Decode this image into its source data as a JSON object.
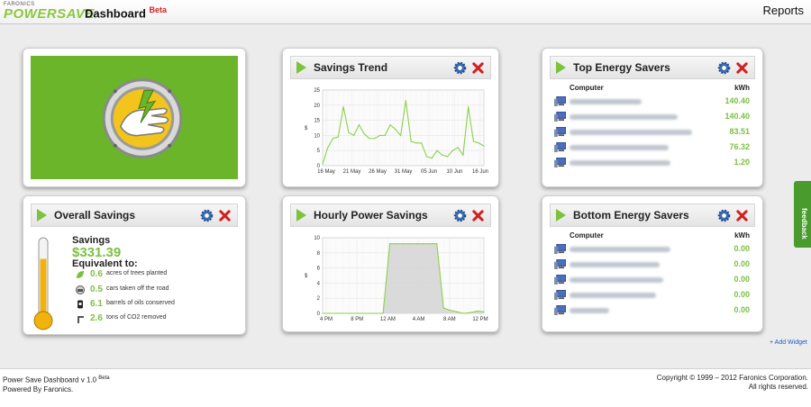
{
  "header": {
    "logo_sub": "FARONICS",
    "logo_main": "POWERSAVE",
    "app_title": "Dashboard",
    "beta": "Beta",
    "reports": "Reports"
  },
  "colors": {
    "accent_green": "#7ac142",
    "logo_green": "#6bb52b",
    "close_red": "#d21f1f"
  },
  "widgets": {
    "savings_trend": {
      "title": "Savings Trend"
    },
    "top_savers": {
      "title": "Top Energy Savers",
      "col_computer": "Computer",
      "col_kwh": "kWh",
      "rows": [
        {
          "kwh": "140.40"
        },
        {
          "kwh": "140.40"
        },
        {
          "kwh": "83.51"
        },
        {
          "kwh": "76.32"
        },
        {
          "kwh": "1.20"
        }
      ]
    },
    "overall_savings": {
      "title": "Overall Savings",
      "savings_label": "Savings",
      "amount": "$331.39",
      "equivalent_label": "Equivalent to:",
      "items": [
        {
          "value": "0.6",
          "text": "acres of trees planted",
          "icon": "leaf-icon"
        },
        {
          "value": "0.5",
          "text": "cars taken off the road",
          "icon": "car-icon"
        },
        {
          "value": "6.1",
          "text": "barrels of oils conserved",
          "icon": "barrel-icon"
        },
        {
          "value": "2.6",
          "text": "tons of CO2 removed",
          "icon": "co2-icon"
        }
      ],
      "thermometer_level": 0.75
    },
    "hourly_savings": {
      "title": "Hourly Power Savings"
    },
    "bottom_savers": {
      "title": "Bottom Energy Savers",
      "col_computer": "Computer",
      "col_kwh": "kWh",
      "rows": [
        {
          "kwh": "0.00"
        },
        {
          "kwh": "0.00"
        },
        {
          "kwh": "0.00"
        },
        {
          "kwh": "0.00"
        },
        {
          "kwh": "0.00"
        }
      ]
    }
  },
  "add_widget": "+ Add Widget",
  "feedback": "feedback",
  "footer": {
    "version": "Power Save Dashboard v 1.0",
    "version_beta": "Beta",
    "powered": "Powered By Faronics.",
    "copyright": "Copyright © 1999 – 2012 Faronics Corporation.",
    "rights": "All rights reserved."
  },
  "chart_data": [
    {
      "type": "line",
      "ylabel": "$",
      "ylim": [
        0,
        25
      ],
      "yticks": [
        0,
        5,
        10,
        15,
        20,
        25
      ],
      "xticks": [
        "16 May",
        "21 May",
        "26 May",
        "31 May",
        "05 Jun",
        "10 Jun",
        "16 Jun"
      ],
      "x": [
        0,
        1,
        2,
        3,
        4,
        5,
        6,
        7,
        8,
        9,
        10,
        11,
        12,
        13,
        14,
        15,
        16,
        17,
        18,
        19,
        20,
        21,
        22,
        23,
        24,
        25,
        26,
        27,
        28,
        29,
        30,
        31
      ],
      "values": [
        0.5,
        6,
        9,
        9.5,
        19.5,
        11,
        10,
        13.5,
        10.5,
        9,
        9,
        10,
        10,
        13.5,
        12,
        10,
        21.5,
        8,
        7.5,
        7.5,
        3,
        2.5,
        5,
        3.5,
        3,
        5,
        6,
        3.5,
        19.5,
        8,
        7.5,
        6.5
      ]
    },
    {
      "type": "line",
      "ylabel": "$",
      "ylim": [
        0,
        10
      ],
      "yticks": [
        0,
        2,
        4,
        6,
        8,
        10
      ],
      "xticks": [
        "4 PM",
        "8 PM",
        "12 AM",
        "4 AM",
        "8 AM",
        "12 PM"
      ],
      "x": [
        0,
        1,
        2,
        3,
        4,
        5,
        6,
        7,
        8,
        9,
        10,
        11,
        12,
        13,
        14,
        15,
        16,
        17,
        18,
        19,
        20,
        21,
        22,
        23,
        24
      ],
      "values": [
        0,
        0,
        0,
        0,
        0,
        0,
        0,
        0,
        0,
        0,
        9.2,
        9.2,
        9.2,
        9.2,
        9.2,
        9.2,
        9.2,
        9.2,
        0.7,
        0.4,
        0.2,
        0,
        0.1,
        0.3,
        0.2
      ]
    }
  ]
}
